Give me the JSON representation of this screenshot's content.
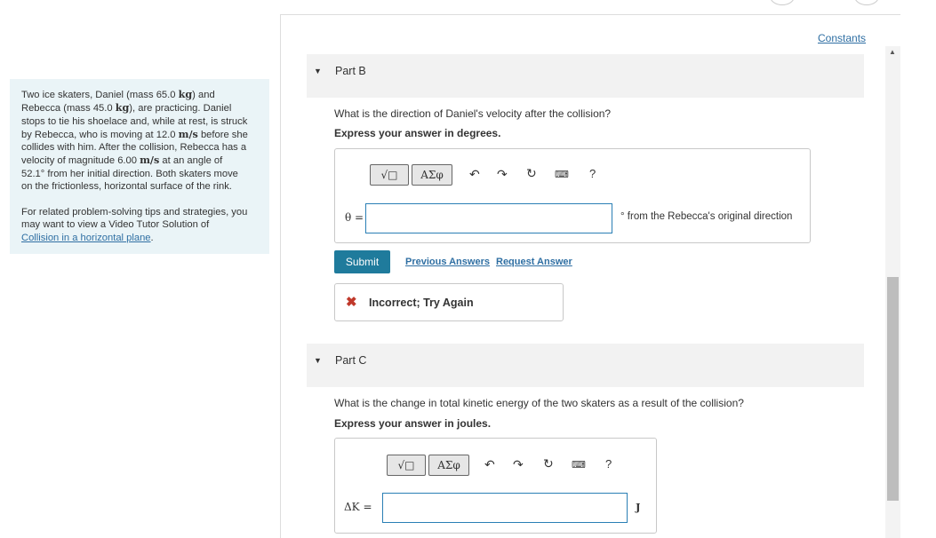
{
  "header": {
    "constants_link": "Constants"
  },
  "problem": {
    "paragraph1_parts": [
      "Two ice skaters, Daniel (mass 65.0 ",
      "kg",
      ") and",
      "Rebecca (mass 45.0 ",
      "kg",
      "), are practicing. Daniel",
      "stops to tie his shoelace and, while at rest, is struck",
      "by Rebecca, who is moving at 12.0 ",
      "m/s",
      " before she",
      "collides with him. After the collision, Rebecca has a",
      "velocity of magnitude 6.00 ",
      "m/s",
      " at an angle of",
      "52.1",
      "°",
      " from her initial direction. Both skaters move",
      "on the frictionless, horizontal surface of the rink."
    ],
    "paragraph2_lines": [
      "For related problem-solving tips and strategies, you",
      "may want to view a Video Tutor Solution of"
    ],
    "video_link": "Collision in a horizontal plane",
    "video_link_suffix": "."
  },
  "part_b": {
    "title": "Part B",
    "question": "What is the direction of Daniel's velocity after the collision?",
    "express": "Express your answer in degrees.",
    "toolbar": {
      "math": "√□",
      "greek": "ΑΣφ",
      "help": "?"
    },
    "input_label": "θ =",
    "input_value": "",
    "unit": "° from the Rebecca's original direction",
    "submit": "Submit",
    "previous_answers": "Previous Answers",
    "request_answer": "Request Answer",
    "feedback": "Incorrect; Try Again"
  },
  "part_c": {
    "title": "Part C",
    "question": "What is the change in total kinetic energy of the two skaters as a result of the collision?",
    "express": "Express your answer in joules.",
    "toolbar": {
      "math": "√□",
      "greek": "ΑΣφ",
      "help": "?"
    },
    "input_label": "ΔK =",
    "input_value": "",
    "unit": "J"
  }
}
